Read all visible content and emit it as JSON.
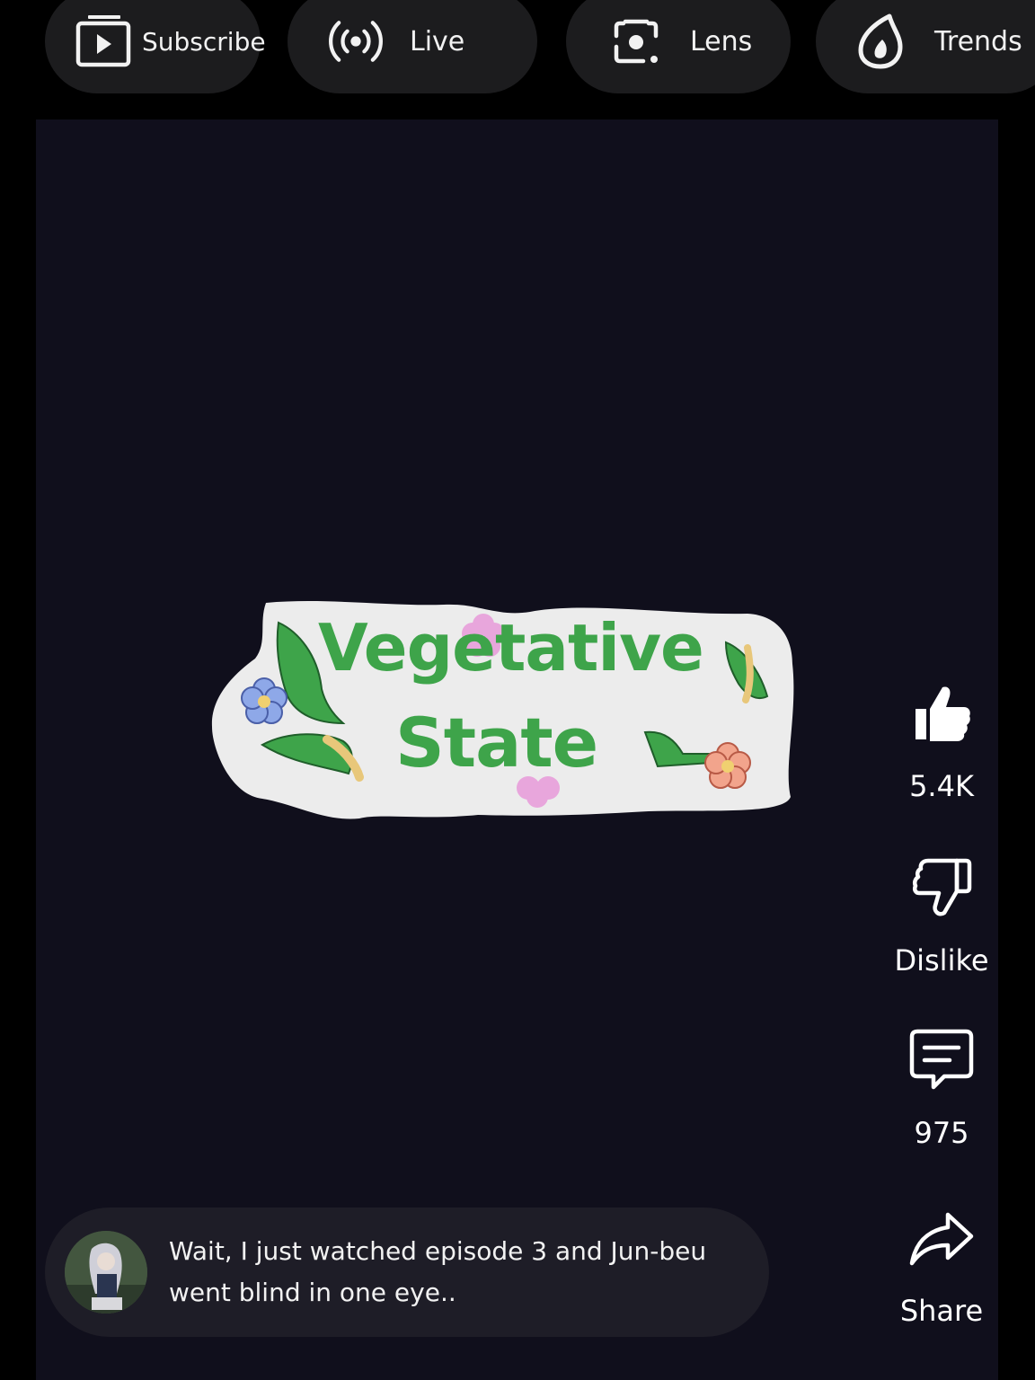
{
  "top_chips": {
    "subscribe": {
      "label": "Subscribe",
      "icon": "subscriptions-icon"
    },
    "live": {
      "label": "Live",
      "icon": "live-broadcast-icon"
    },
    "lens": {
      "label": "Lens",
      "icon": "lens-camera-icon"
    },
    "trends": {
      "label": "Trends",
      "icon": "trending-flame-icon"
    }
  },
  "video": {
    "title_sticker": {
      "line1": "Vegetative",
      "line2": "State"
    }
  },
  "actions": {
    "like": {
      "label": "5.4K",
      "icon": "thumbs-up-icon"
    },
    "dislike": {
      "label": "Dislike",
      "icon": "thumbs-down-icon"
    },
    "comments": {
      "label": "975",
      "icon": "comment-icon"
    },
    "share": {
      "label": "Share",
      "icon": "share-arrow-icon"
    }
  },
  "comment_preview": {
    "text": "Wait, I just watched episode 3 and Jun-beu went blind in one eye.."
  },
  "colors": {
    "background": "#000000",
    "video_background": "#100f1c",
    "chip_background": "#1c1c1e",
    "comment_background": "#1e1d27",
    "sticker_green": "#3ea44a",
    "sticker_paper": "#ececec"
  }
}
